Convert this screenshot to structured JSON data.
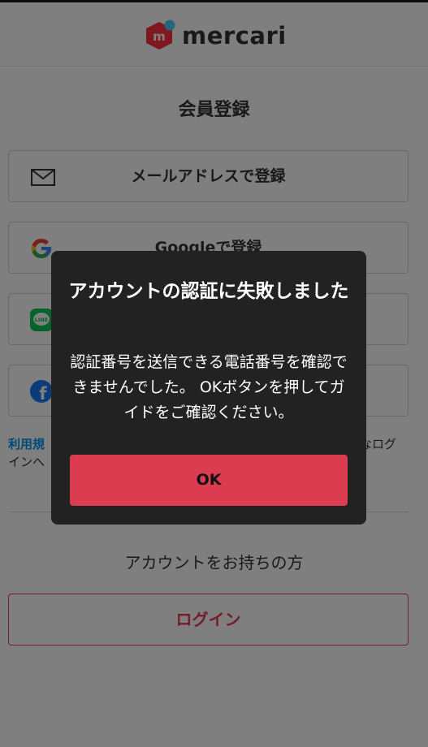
{
  "header": {
    "logo_text": "mercari",
    "logo_letter": "m"
  },
  "page_title": "会員登録",
  "signup_buttons": [
    {
      "label": "メールアドレスで登録",
      "icon": "mail-icon"
    },
    {
      "label": "Googleで登録",
      "icon": "google-icon"
    },
    {
      "label": "",
      "icon": "line-icon",
      "icon_text": "LINE"
    },
    {
      "label": "",
      "icon": "facebook-icon",
      "icon_text": "f"
    }
  ],
  "terms": {
    "link_text": "利用規",
    "line2": "インへ",
    "right_text": "なログ"
  },
  "account_section": {
    "prompt": "アカウントをお持ちの方",
    "login_label": "ログイン"
  },
  "dialog": {
    "title": "アカウントの認証に失敗しました",
    "message": "認証番号を送信できる電話番号を確認できませんでした。 OKボタンを押してガイドをご確認ください。",
    "ok_label": "OK"
  },
  "colors": {
    "brand": "#e8384f",
    "link": "#0095ee",
    "dialog_bg": "#222222",
    "ok_button": "#db3c50"
  }
}
